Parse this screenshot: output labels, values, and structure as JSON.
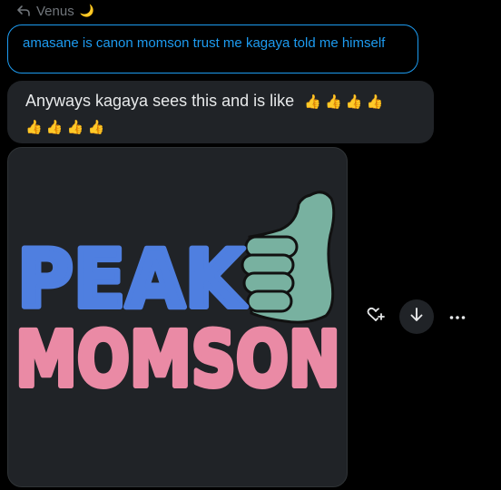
{
  "reply": {
    "label": "Venus",
    "moon": "🌙"
  },
  "quoted_message": {
    "text": "amasane is canon momson trust me kagaya told me himself"
  },
  "message": {
    "text": "Anyways kagaya sees this and is like",
    "emoji_line1": "👍 👍 👍 👍",
    "emoji_line2": "👍 👍 👍 👍"
  },
  "image": {
    "line1": "PEAK",
    "line2": "MOMSON",
    "colors": {
      "peak": "#4f7fe0",
      "momson": "#ea8aa5",
      "thumb": "#78b1a0",
      "background": "#202327"
    }
  },
  "icons": {
    "reply": "reply-arrow-icon",
    "react": "heart-plus-icon",
    "download": "download-arrow-icon",
    "more": "more-dots-icon"
  },
  "colors": {
    "link": "#1d9bf0",
    "muted": "#71767b",
    "bubble": "#202327"
  }
}
